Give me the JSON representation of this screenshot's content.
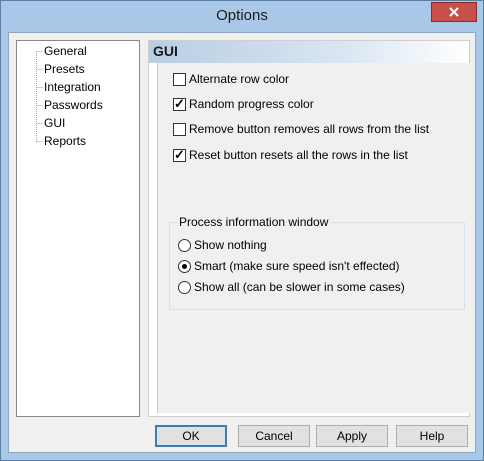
{
  "window": {
    "title": "Options"
  },
  "tree": {
    "items": [
      {
        "label": "General"
      },
      {
        "label": "Presets"
      },
      {
        "label": "Integration"
      },
      {
        "label": "Passwords"
      },
      {
        "label": "GUI"
      },
      {
        "label": "Reports"
      }
    ],
    "selected": "GUI"
  },
  "panel": {
    "title": "GUI",
    "checkboxes": [
      {
        "label": "Alternate row color",
        "checked": false
      },
      {
        "label": "Random progress color",
        "checked": true
      },
      {
        "label": "Remove button removes all rows from the list",
        "checked": false
      },
      {
        "label": "Reset button resets all the rows in the list",
        "checked": true
      }
    ],
    "group": {
      "label": "Process information window",
      "options": [
        {
          "label": "Show nothing",
          "selected": false
        },
        {
          "label": "Smart (make sure speed isn't effected)",
          "selected": true
        },
        {
          "label": "Show all (can be slower in some cases)",
          "selected": false
        }
      ]
    }
  },
  "buttons": {
    "ok": "OK",
    "cancel": "Cancel",
    "apply": "Apply",
    "help": "Help"
  },
  "colors": {
    "frame": "#a9c8e8",
    "close_button": "#c7504a",
    "client": "#f0f0f0"
  }
}
